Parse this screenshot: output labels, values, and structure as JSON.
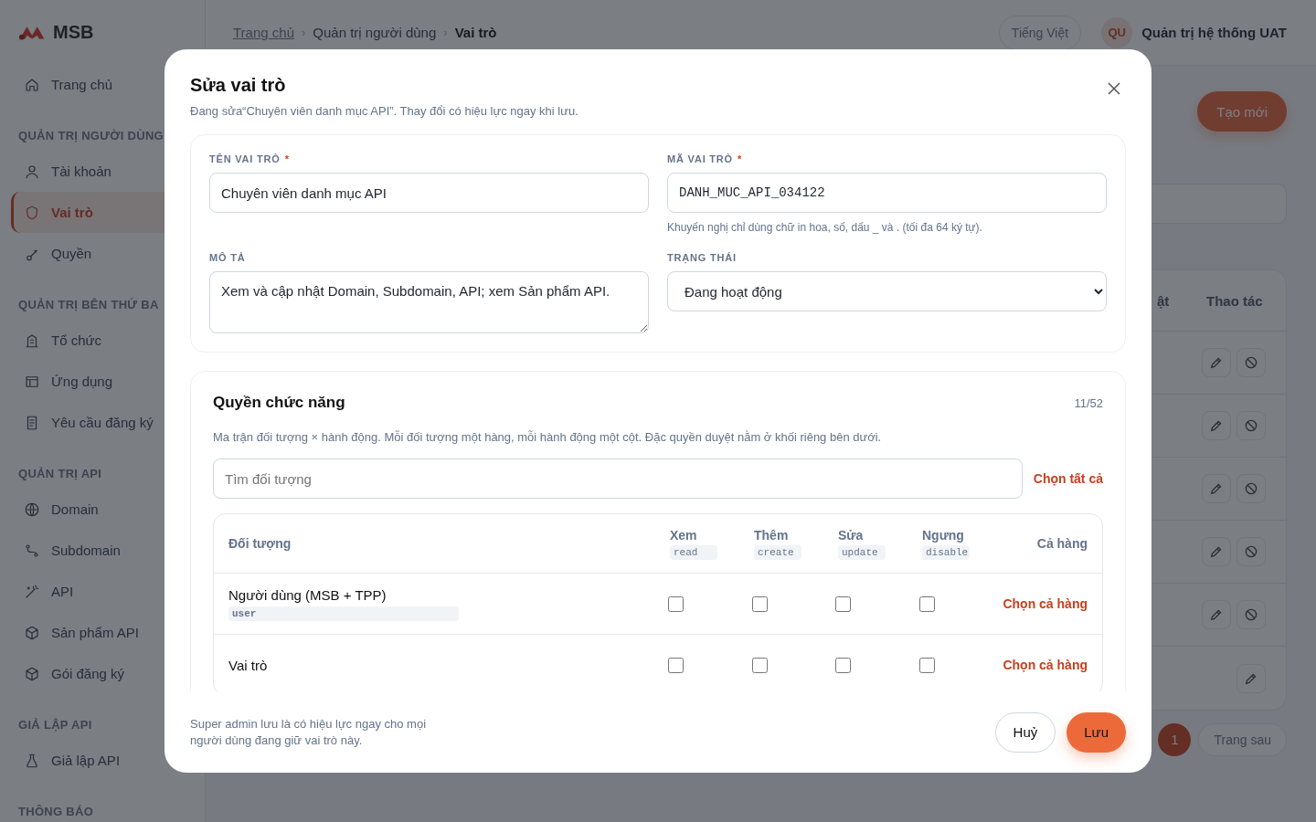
{
  "brand": {
    "name": "MSB"
  },
  "breadcrumb": [
    {
      "kind": "link",
      "label": "Trang chủ"
    },
    {
      "kind": "separator",
      "label": "›"
    },
    {
      "kind": "text",
      "label": "Quản trị người dùng"
    },
    {
      "kind": "separator",
      "label": "›"
    },
    {
      "kind": "current",
      "label": "Vai trò"
    }
  ],
  "header": {
    "language": "Tiếng Việt",
    "avatar": "QU",
    "user_name": "Quản trị hệ thống UAT"
  },
  "sidebar": {
    "sections": [
      {
        "items": [
          {
            "label": "Trang chủ",
            "selected": false
          }
        ]
      },
      {
        "title": "QUẢN TRỊ NGƯỜI DÙNG",
        "items": [
          {
            "label": "Tài khoản",
            "selected": false
          },
          {
            "label": "Vai trò",
            "selected": true
          },
          {
            "label": "Quyền",
            "selected": false
          }
        ]
      },
      {
        "title": "QUẢN TRỊ BÊN THỨ BA",
        "items": [
          {
            "label": "Tổ chức",
            "selected": false
          },
          {
            "label": "Ứng dụng",
            "selected": false
          },
          {
            "label": "Yêu cầu đăng ký",
            "selected": false
          }
        ]
      },
      {
        "title": "QUẢN TRỊ API",
        "items": [
          {
            "label": "Domain",
            "selected": false
          },
          {
            "label": "Subdomain",
            "selected": false
          },
          {
            "label": "API",
            "selected": false
          },
          {
            "label": "Sản phẩm API",
            "selected": false
          },
          {
            "label": "Gói đăng ký",
            "selected": false
          }
        ]
      },
      {
        "title": "GIẢ LẬP API",
        "items": [
          {
            "label": "Giả lập API",
            "selected": false
          }
        ]
      },
      {
        "title": "THÔNG BÁO"
      }
    ]
  },
  "page": {
    "create_button": "Tạo mới",
    "table": {
      "columns": [
        "ật",
        "Thao tác"
      ],
      "rows": [
        {
          "can_disable": true
        },
        {
          "can_disable": true
        },
        {
          "can_disable": true
        },
        {
          "can_disable": true
        },
        {
          "can_disable": true
        },
        {
          "can_disable": false
        }
      ]
    },
    "pagination": {
      "pages": [
        {
          "label": "1",
          "selected": true
        }
      ],
      "next": "Trang sau"
    }
  },
  "modal": {
    "title": "Sửa vai trò",
    "subtitle": "Đang sửa“Chuyên viên danh mục API”. Thay đổi có hiệu lực ngay khi lưu.",
    "fields": [
      {
        "kind": "text",
        "label": "TÊN VAI TRÒ",
        "mark": "*",
        "value": "Chuyên viên danh mục API"
      },
      {
        "kind": "code",
        "label": "MÃ VAI TRÒ",
        "mark": "*",
        "value": "DANH_MUC_API_034122",
        "hint": "Khuyến nghị chỉ dùng chữ in hoa, số, dấu _ và . (tối đa 64 ký tự)."
      },
      {
        "kind": "textarea",
        "label": "MÔ TẢ",
        "value": "Xem và cập nhật Domain, Subdomain, API; xem Sản phẩm API."
      },
      {
        "kind": "select",
        "label": "TRẠNG THÁI",
        "value": "Đang hoạt động"
      }
    ],
    "permissions": {
      "title": "Quyền chức năng",
      "count": "11/52",
      "description": "Ma trận đối tượng × hành động. Mỗi đối tượng một hàng, mỗi hành động một cột. Đặc quyền duyệt nằm ở khối riêng bên dưới.",
      "search": {
        "placeholder": "Tìm đối tượng"
      },
      "select_all": "Chọn tất cả",
      "object_header": "Đối tượng",
      "row_header": "Cả hàng",
      "actions": [
        {
          "label": "Xem",
          "code": "read"
        },
        {
          "label": "Thêm",
          "code": "create"
        },
        {
          "label": "Sửa",
          "code": "update"
        },
        {
          "label": "Ngưng",
          "code": "disable"
        }
      ],
      "rows": [
        {
          "name": "Người dùng (MSB + TPP)",
          "code": "user",
          "checked": [
            false,
            false,
            false,
            false
          ],
          "row_link": "Chọn cả hàng"
        },
        {
          "name": "Vai trò",
          "checked": [
            false,
            false,
            false,
            false
          ],
          "row_link": "Chọn cả hàng"
        }
      ]
    },
    "footer_note": "Super admin lưu là có hiệu lực ngay cho mọi người dùng đang giữ vai trò này.",
    "buttons": [
      {
        "label": "Huỷ",
        "kind": "secondary"
      },
      {
        "label": "Lưu",
        "kind": "primary"
      }
    ]
  }
}
